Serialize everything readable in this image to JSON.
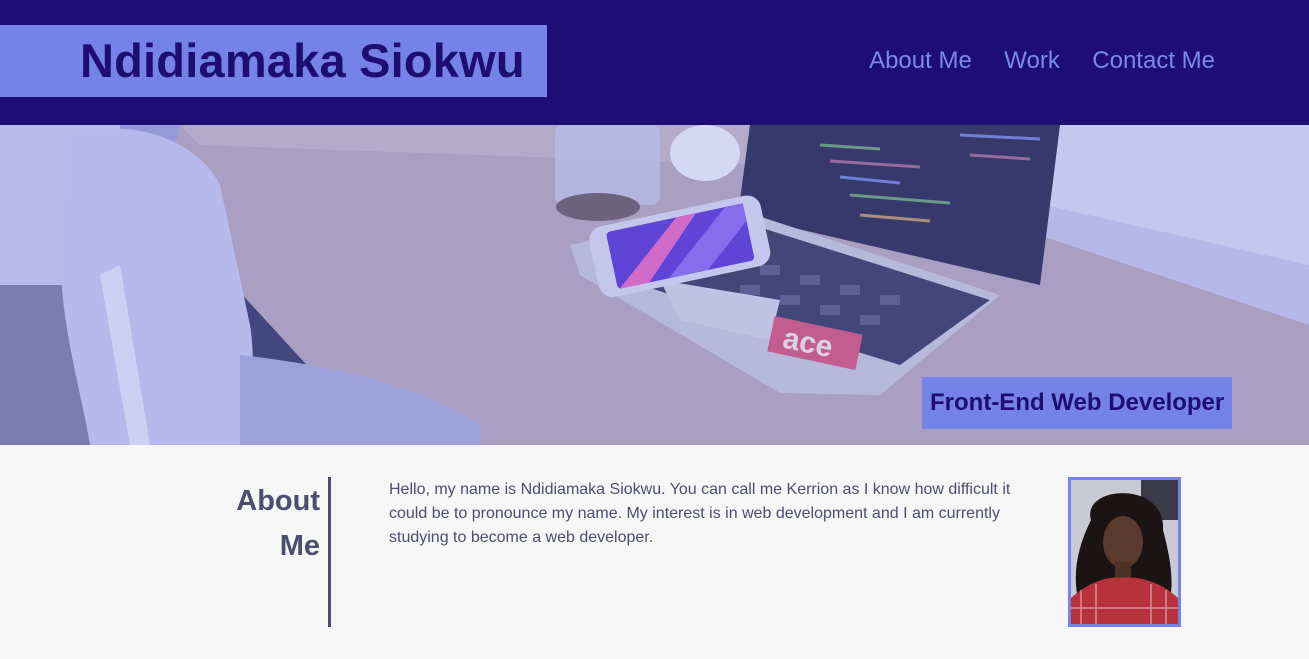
{
  "header": {
    "site_title": "Ndidiamaka Siokwu",
    "nav": [
      "About Me",
      "Work",
      "Contact Me"
    ]
  },
  "hero": {
    "image": "desk-with-laptop-and-phone",
    "tagline": "Front-End Web Developer",
    "sticker_text": "ace"
  },
  "about": {
    "heading_line1": "About",
    "heading_line2": "Me",
    "paragraph": "Hello, my name is Ndidiamaka Siokwu. You can call me Kerrion as I know how difficult it could be to pronounce my name. My interest is in web development and I am currently studying to become a web developer.",
    "portrait": "profile-photo"
  },
  "colors": {
    "header_bg": "#1e0e73",
    "accent": "#7583e8",
    "nav_text": "#7a8ae6",
    "body_text": "#4c4e6e",
    "page_bg": "#f6f6f6"
  }
}
